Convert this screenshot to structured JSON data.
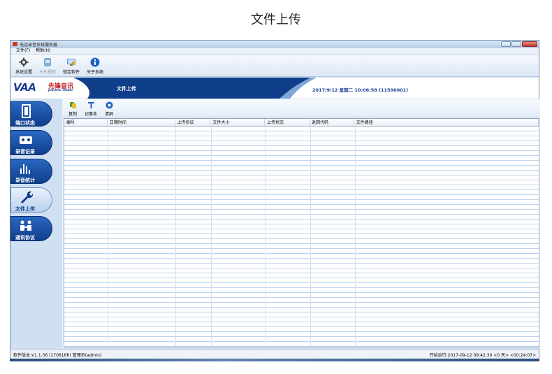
{
  "page": {
    "heading": "文件上传"
  },
  "window": {
    "title": "电话录音系统服务器",
    "menu": [
      "文件(F)",
      "帮助(H)"
    ],
    "toolbar": [
      {
        "label": "系统设置",
        "icon": "gear-icon",
        "enabled": true
      },
      {
        "label": "卡片授权",
        "icon": "card-icon",
        "enabled": false
      },
      {
        "label": "锁定软件",
        "icon": "lock-screen-icon",
        "enabled": true
      },
      {
        "label": "关于系统",
        "icon": "info-icon",
        "enabled": true
      }
    ]
  },
  "banner": {
    "logo_text": "VAA",
    "logo_cn": "先锋音讯",
    "logo_en": "pioneer audio",
    "section_title": "文件上传",
    "clock": "2017/9/12 星期二 10:06:58 (11500001)"
  },
  "nav": [
    {
      "label": "端口状态",
      "icon": "door-icon",
      "active": false
    },
    {
      "label": "录音记录",
      "icon": "cassette-icon",
      "active": false
    },
    {
      "label": "录音统计",
      "icon": "bar-chart-icon",
      "active": false
    },
    {
      "label": "文件上传",
      "icon": "wrench-icon",
      "active": true
    },
    {
      "label": "通讯协议",
      "icon": "people-icon",
      "active": false
    }
  ],
  "sub_toolbar": [
    {
      "label": "复制",
      "icon": "copy-icon"
    },
    {
      "label": "记事本",
      "icon": "notepad-icon"
    },
    {
      "label": "清屏",
      "icon": "clear-icon"
    }
  ],
  "grid": {
    "columns": [
      "编号",
      "日期时间",
      "上传协议",
      "文件大小",
      "上传状态",
      "返回代码",
      "文件路径"
    ]
  },
  "status": {
    "left": "软件版本:V1.1.56 (170616R) 管理员(admin)",
    "right": "开始运行:2017-09-12 09:42:30 <0 天> <00:24:07>"
  },
  "colors": {
    "brand_blue": "#1c3f94",
    "brand_red": "#c6252b",
    "nav_blue": "#0f3e8a"
  }
}
